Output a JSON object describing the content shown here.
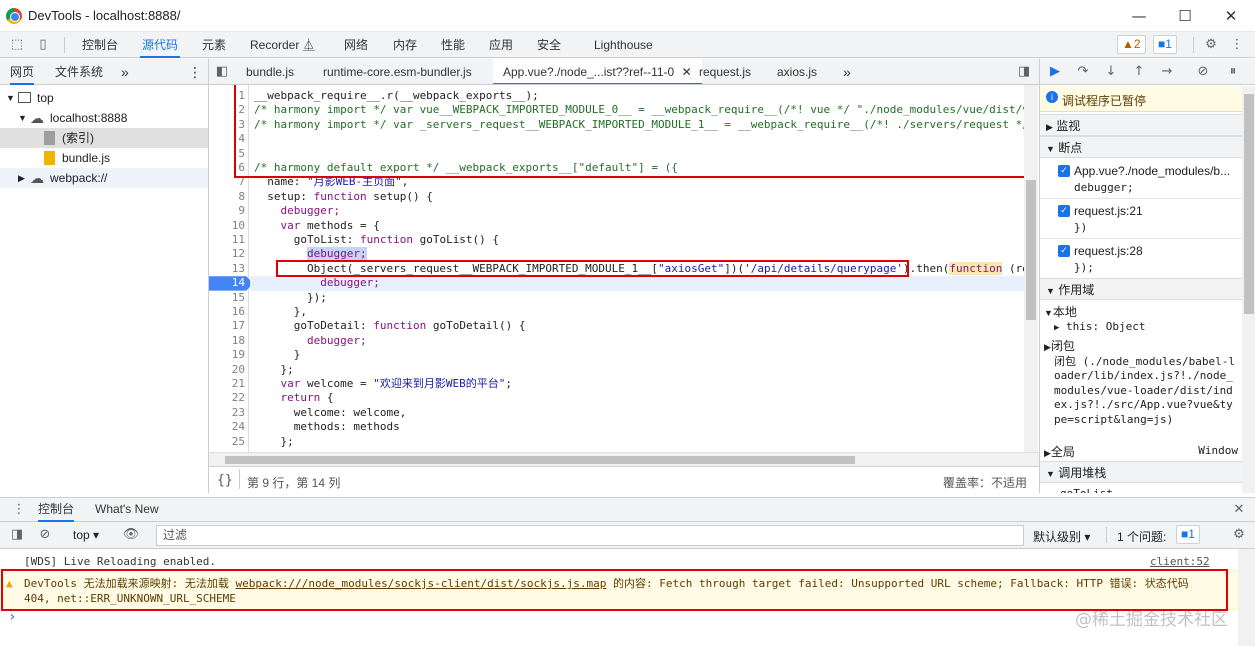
{
  "window": {
    "title": "DevTools - localhost:8888/",
    "minimize": "—",
    "maximize": "☐",
    "close": "✕"
  },
  "main_toolbar": {
    "tabs": [
      "控制台",
      "源代码",
      "元素",
      "Recorder ⏅",
      "网络",
      "内存",
      "性能",
      "应用",
      "安全",
      "Lighthouse"
    ],
    "active_tab": "源代码",
    "warnings_badge": "▲2",
    "issues_badge": "■1"
  },
  "navigator": {
    "tabs": [
      "网页",
      "文件系统"
    ],
    "more": "»",
    "tree": [
      {
        "label": "top",
        "icon": "frame-icon"
      },
      {
        "label": "localhost:8888",
        "icon": "cloud-icon"
      },
      {
        "label": "(索引)",
        "icon": "file-gray-icon"
      },
      {
        "label": "bundle.js",
        "icon": "file-yellow-icon"
      },
      {
        "label": "webpack://",
        "icon": "cloud-icon"
      }
    ]
  },
  "editor": {
    "tabs": [
      {
        "label": "bundle.js"
      },
      {
        "label": "runtime-core.esm-bundler.js"
      },
      {
        "label": "App.vue?./node_...ist??ref--11-0"
      },
      {
        "label": "request.js"
      },
      {
        "label": "axios.js"
      }
    ],
    "active_tab_close": "✕",
    "more_tabs": "»",
    "line_numbers": [
      "1",
      "2",
      "3",
      "4",
      "5",
      "6",
      "7",
      "8",
      "9",
      "10",
      "11",
      "12",
      "13",
      "14",
      "15",
      "16",
      "17",
      "18",
      "19",
      "20",
      "21",
      "22",
      "23",
      "24",
      "25"
    ],
    "paused_line": "14",
    "status_position": "第 9 行，第 14 列",
    "coverage": "覆盖率：不适用",
    "format_icon": "{}"
  },
  "code_lines": {
    "l1": "__webpack_require__.r(__webpack_exports__);",
    "l2a": "/* harmony import */ var vue__WEBPACK_IMPORTED_MODULE_0__ = __webpack_require__(/*! vue */ \"./node_modules/vue/dist/v",
    "l3a": "/* harmony import */ var _servers_request__WEBPACK_IMPORTED_MODULE_1__ = __webpack_require__(/*! ./servers/request */",
    "l6": "/* harmony default export */ __webpack_exports__[\"default\"] = ({",
    "l7a": "  name: ",
    "l7b": "\"月影WEB-主页面\"",
    "l7c": ",",
    "l8a": "  setup: ",
    "l8b": "function",
    "l8c": " setup() {",
    "l9": "    debugger;",
    "l10a": "    ",
    "l10b": "var",
    "l10c": " methods = {",
    "l11a": "      goToList: ",
    "l11b": "function",
    "l11c": " goToList() {",
    "l12": "debugger;",
    "l13a": "Object(_servers_request__WEBPACK_IMPORTED_MODULE_1__[",
    "l13b": "\"axiosGet\"",
    "l13c": "])(",
    "l13d": "'/api/details/querypage'",
    "l13e": ").then(",
    "l13f": "function",
    "l13g": " (re",
    "l14": "          debugger;",
    "l15": "        });",
    "l16": "      },",
    "l17a": "      goToDetail: ",
    "l17b": "function",
    "l17c": " goToDetail() {",
    "l18": "        debugger;",
    "l19": "      }",
    "l20": "    };",
    "l21a": "    ",
    "l21b": "var",
    "l21c": " welcome = ",
    "l21d": "\"欢迎来到月影WEB的平台\"",
    "l21e": ";",
    "l22a": "    ",
    "l22b": "return",
    "l22c": " {",
    "l23": "      welcome: welcome,",
    "l24": "      methods: methods",
    "l25": "    };"
  },
  "debugger": {
    "paused_message": "调试程序已暂停",
    "sections": {
      "watch": "监视",
      "breakpoints": "断点",
      "scope": "作用域",
      "callstack": "调用堆栈"
    },
    "breakpoints": [
      {
        "file": "App.vue?./node_modules/b...",
        "code": "debugger;"
      },
      {
        "file": "request.js:21",
        "code": "})"
      },
      {
        "file": "request.js:28",
        "code": "});"
      }
    ],
    "scope": {
      "local": "本地",
      "this": "this: Object",
      "closure": "闭包",
      "closure2": "闭包 (./node_modules/babel-loader/lib/index.js?!./node_modules/vue-loader/dist/index.js?!./src/App.vue?vue&type=script&lang=js)",
      "global": "全局",
      "global_value": "Window"
    },
    "callstack_first": "goToList"
  },
  "drawer": {
    "tabs": [
      "控制台",
      "What's New"
    ],
    "close": "✕"
  },
  "console_toolbar": {
    "context": "top",
    "filter_placeholder": "过滤",
    "levels": "默认级别 ▾",
    "issues": "1 个问题:",
    "issues_count": "■1"
  },
  "console": {
    "msg1": "[WDS] Live Reloading enabled.",
    "msg1_source": "client:52",
    "warn_prefix": "DevTools 无法加载来源映射: 无法加载 ",
    "warn_link": "webpack:///node_modules/sockjs-client/dist/sockjs.js.map",
    "warn_suffix": " 的内容: Fetch through target failed: Unsupported URL scheme; Fallback: HTTP 错误: 状态代码",
    "warn_line2": "404, net::ERR_UNKNOWN_URL_SCHEME",
    "prompt": "›"
  },
  "watermark": "@稀土掘金技术社区",
  "colors": {
    "accent": "#1a73e8",
    "highlight_box": "#e00000",
    "paused_line": "#4285f4"
  }
}
